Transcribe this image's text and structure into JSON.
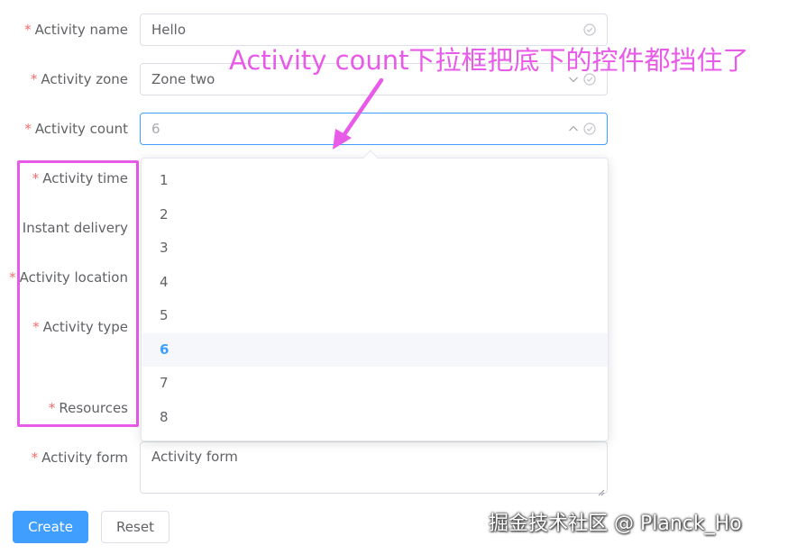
{
  "form": {
    "activity_name": {
      "label": "Activity name",
      "required": "*",
      "value": "Hello"
    },
    "activity_zone": {
      "label": "Activity zone",
      "required": "*",
      "value": "Zone two"
    },
    "activity_count": {
      "label": "Activity count",
      "required": "*",
      "value": "6"
    },
    "activity_time": {
      "label": "Activity time",
      "required": "*"
    },
    "instant_delivery": {
      "label": "Instant delivery"
    },
    "activity_location": {
      "label": "Activity location",
      "required": "*"
    },
    "activity_type": {
      "label": "Activity type",
      "required": "*"
    },
    "resources": {
      "label": "Resources",
      "required": "*"
    },
    "activity_form": {
      "label": "Activity form",
      "required": "*",
      "value": "Activity form"
    }
  },
  "dropdown": {
    "options": [
      "1",
      "2",
      "3",
      "4",
      "5",
      "6",
      "7",
      "8"
    ],
    "selected": "6"
  },
  "buttons": {
    "create": "Create",
    "reset": "Reset"
  },
  "annotation": {
    "text": "Activity count下拉框把底下的控件都挡住了"
  },
  "watermark": "掘金技术社区 @ Planck_Ho",
  "colors": {
    "primary": "#409eff",
    "required": "#f56c6c",
    "annotation": "#e85be8",
    "border": "#dcdfe6"
  },
  "icons": {
    "validate": "circle-check-icon",
    "arrow_down": "chevron-down-icon",
    "arrow_up": "chevron-up-icon"
  }
}
